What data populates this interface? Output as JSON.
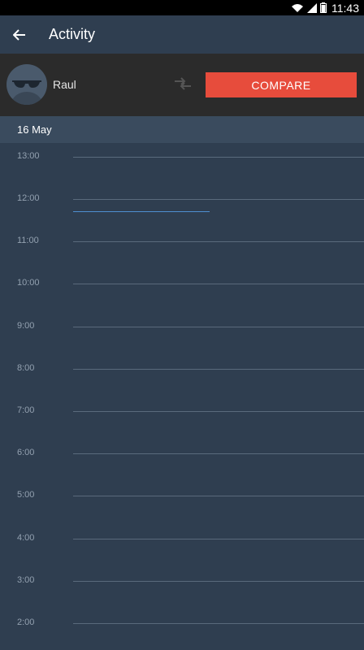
{
  "status_bar": {
    "time": "11:43",
    "icons": [
      "wifi-icon",
      "signal-icon",
      "battery-icon"
    ]
  },
  "app_bar": {
    "title": "Activity",
    "back_icon": "arrow-left-icon"
  },
  "profile": {
    "name": "Raul",
    "avatar_icon": "incognito-avatar-icon",
    "swap_icon": "swap-icon",
    "compare_label": "COMPARE"
  },
  "date_bar": {
    "date": "16 May"
  },
  "timeline": {
    "hours": [
      "13:00",
      "12:00",
      "11:00",
      "10:00",
      "9:00",
      "8:00",
      "7:00",
      "6:00",
      "5:00",
      "4:00",
      "3:00",
      "2:00"
    ],
    "activity_fraction": 0.47
  },
  "colors": {
    "background": "#2f3e50",
    "profile_bar": "#2b2b2b",
    "date_bar": "#3a4b5e",
    "accent": "#e74c3c",
    "activity_line": "#4e8fd0",
    "grid_line": "#5a6a7c"
  }
}
